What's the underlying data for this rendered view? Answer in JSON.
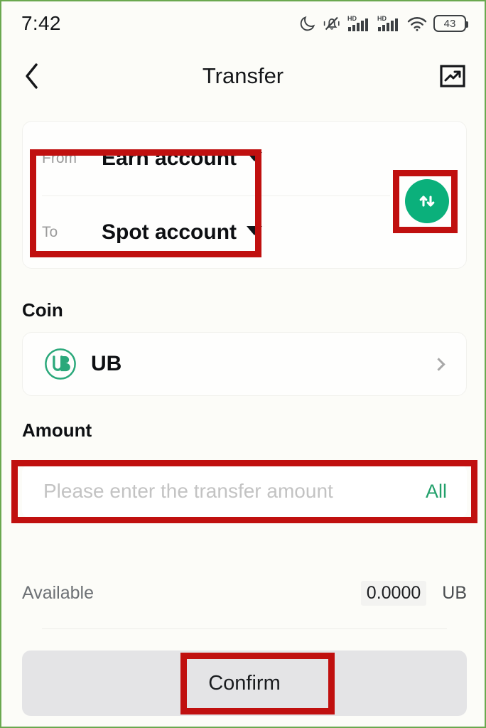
{
  "status_bar": {
    "time": "7:42",
    "battery_percent": "43",
    "icons": [
      "moon-icon",
      "bell-muted-icon",
      "hd-signal-icon",
      "hd-signal-icon",
      "wifi-icon",
      "battery-icon"
    ]
  },
  "nav": {
    "back_icon": "chevron-left-icon",
    "title": "Transfer",
    "history_icon": "chart-trending-up-icon"
  },
  "accounts": {
    "from": {
      "label": "From",
      "value": "Earn account",
      "caret_icon": "caret-down-icon"
    },
    "to": {
      "label": "To",
      "value": "Spot account",
      "caret_icon": "caret-down-icon"
    },
    "swap_icon": "swap-vertical-arrows-icon"
  },
  "coin": {
    "heading": "Coin",
    "logo_icon": "ub-token-icon",
    "symbol": "UB",
    "chevron_icon": "chevron-right-icon"
  },
  "amount": {
    "heading": "Amount",
    "value": "",
    "placeholder": "Please enter the transfer amount",
    "all_label": "All"
  },
  "available": {
    "label": "Available",
    "value": "0.0000",
    "unit": "UB"
  },
  "confirm": {
    "label": "Confirm"
  },
  "colors": {
    "brand_green": "#0bb07b",
    "link_green": "#22a06b",
    "annotation_red": "#c0100f",
    "page_background": "#fcfcf8",
    "frame_green": "#6aa84f",
    "disabled_button": "#e4e4e6"
  }
}
